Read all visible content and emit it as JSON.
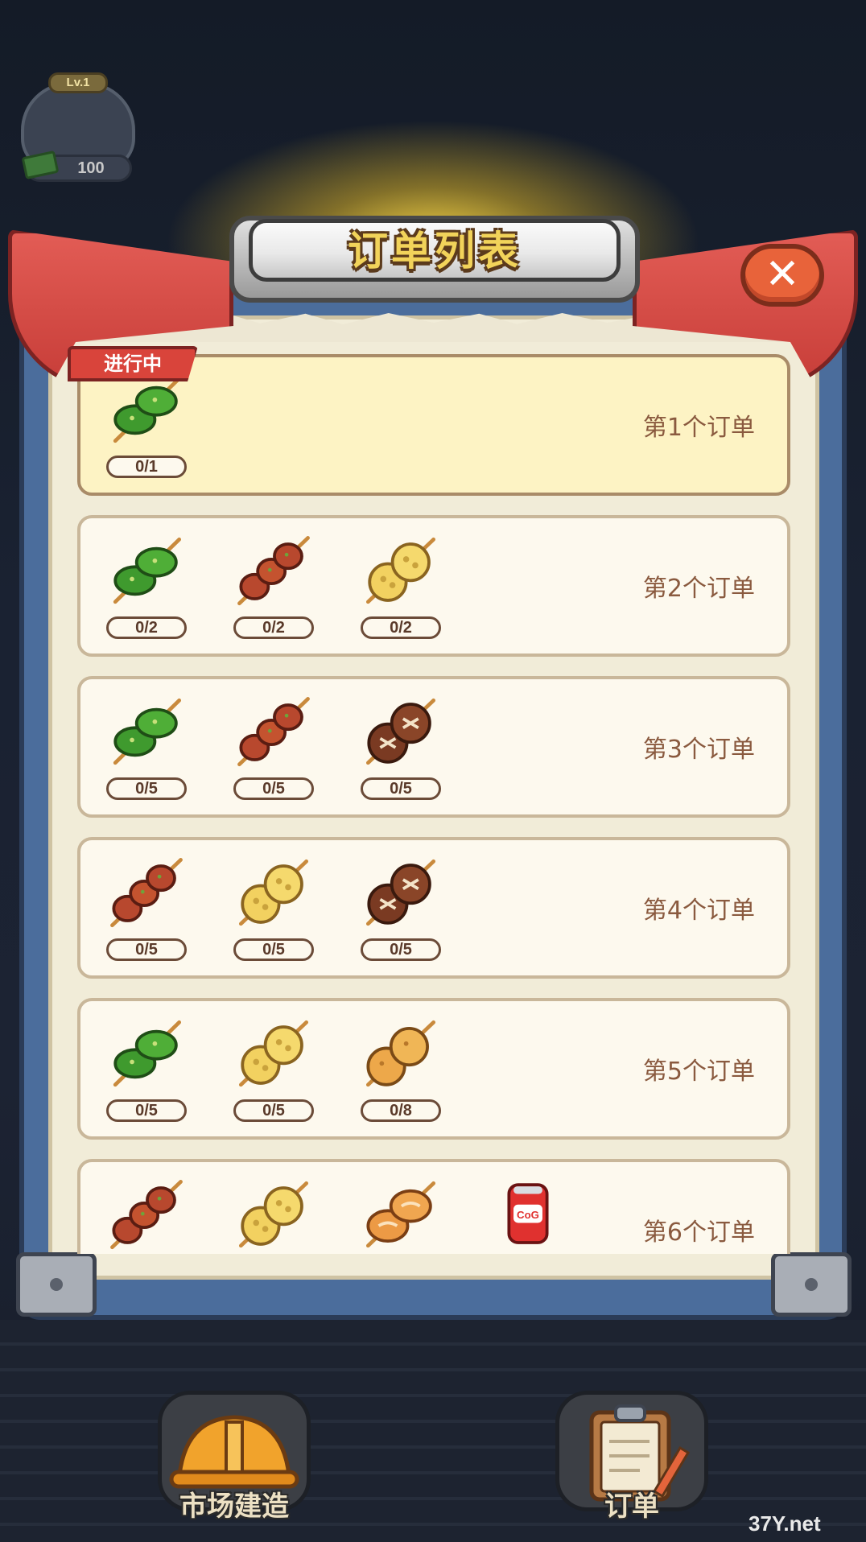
{
  "player": {
    "level": "Lv.1",
    "money": "100"
  },
  "dialog": {
    "title": "订单列表",
    "status_tag": "进行中"
  },
  "orders": [
    {
      "label": "第1个订单",
      "active": true,
      "items": [
        {
          "icon": "pepper-skewer-icon",
          "count": "0/1"
        }
      ]
    },
    {
      "label": "第2个订单",
      "active": false,
      "items": [
        {
          "icon": "pepper-skewer-icon",
          "count": "0/2"
        },
        {
          "icon": "meat-skewer-icon",
          "count": "0/2"
        },
        {
          "icon": "lotus-skewer-icon",
          "count": "0/2"
        }
      ]
    },
    {
      "label": "第3个订单",
      "active": false,
      "items": [
        {
          "icon": "pepper-skewer-icon",
          "count": "0/5"
        },
        {
          "icon": "meat-skewer-icon",
          "count": "0/5"
        },
        {
          "icon": "mushroom-skewer-icon",
          "count": "0/5"
        }
      ]
    },
    {
      "label": "第4个订单",
      "active": false,
      "items": [
        {
          "icon": "meat-skewer-icon",
          "count": "0/5"
        },
        {
          "icon": "lotus-skewer-icon",
          "count": "0/5"
        },
        {
          "icon": "mushroom-skewer-icon",
          "count": "0/5"
        }
      ]
    },
    {
      "label": "第5个订单",
      "active": false,
      "items": [
        {
          "icon": "pepper-skewer-icon",
          "count": "0/5"
        },
        {
          "icon": "lotus-skewer-icon",
          "count": "0/5"
        },
        {
          "icon": "potato-skewer-icon",
          "count": "0/8"
        }
      ]
    },
    {
      "label": "第6个订单",
      "active": false,
      "items": [
        {
          "icon": "meat-skewer-icon",
          "count": ""
        },
        {
          "icon": "lotus-skewer-icon",
          "count": ""
        },
        {
          "icon": "bread-skewer-icon",
          "count": ""
        },
        {
          "icon": "cola-can-icon",
          "count": ""
        }
      ]
    }
  ],
  "bottom_nav": [
    {
      "label": "市场建造",
      "icon": "hard-hat-icon"
    },
    {
      "label": "订单",
      "icon": "clipboard-icon"
    }
  ],
  "watermark": "37Y.net",
  "colors": {
    "accent_red": "#d9443b",
    "title_gold": "#f2d35a",
    "card_active": "#fdf3c4"
  }
}
